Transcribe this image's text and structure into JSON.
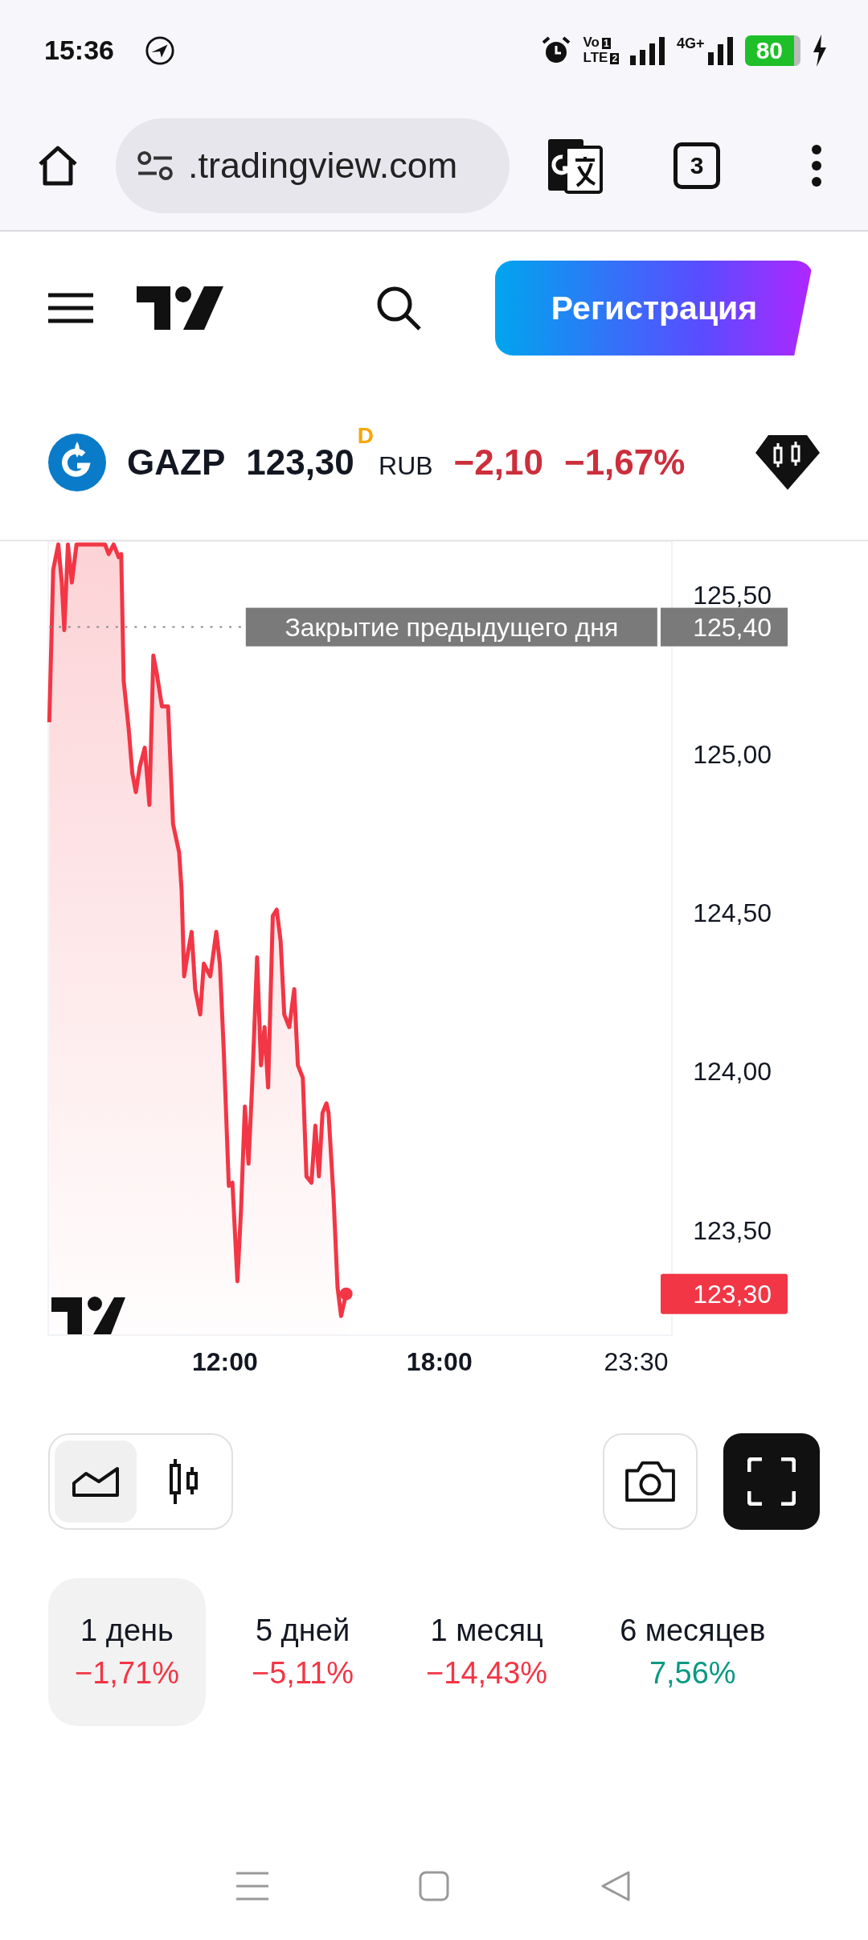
{
  "status_bar": {
    "time": "15:36",
    "volte_top": "Vo",
    "volte_bottom": "LTE",
    "sims": [
      "1",
      "2"
    ],
    "network": "4G+",
    "battery": "80"
  },
  "browser": {
    "url": ".tradingview.com",
    "tab_count": "3"
  },
  "header": {
    "signup_button": "Регистрация"
  },
  "ticker": {
    "symbol": "GAZP",
    "price": "123,30",
    "badge": "D",
    "currency": "RUB",
    "change": "−2,10",
    "change_percent": "−1,67%"
  },
  "chart": {
    "previous_close_value": "125,40",
    "last_price": "123,30",
    "chart_data": {
      "type": "area",
      "xlim": [
        7.06,
        24.5
      ],
      "ylim": [
        123.17,
        125.67
      ],
      "xticks": [
        {
          "value": 12,
          "label": "12:00"
        },
        {
          "value": 18,
          "label": "18:00"
        },
        {
          "value": 23.5,
          "label": "23:30"
        }
      ],
      "yticks": [
        {
          "value": 123.5,
          "label": "123,50"
        },
        {
          "value": 124,
          "label": "124,00"
        },
        {
          "value": 124.5,
          "label": "124,50"
        },
        {
          "value": 125,
          "label": "125,00"
        },
        {
          "value": 125.5,
          "label": "125,50"
        }
      ],
      "x": [
        7.09,
        7.2,
        7.34,
        7.44,
        7.51,
        7.61,
        7.72,
        7.85,
        8.13,
        8.65,
        8.75,
        8.89,
        9.03,
        9.1,
        9.17,
        9.31,
        9.41,
        9.51,
        9.62,
        9.76,
        9.89,
        10.0,
        10.1,
        10.24,
        10.41,
        10.55,
        10.72,
        10.79,
        10.86,
        10.96,
        11.07,
        11.17,
        11.31,
        11.41,
        11.59,
        11.76,
        11.86,
        11.97,
        12.11,
        12.21,
        12.35,
        12.45,
        12.56,
        12.66,
        12.76,
        12.9,
        13.01,
        13.11,
        13.21,
        13.34,
        13.45,
        13.56,
        13.66,
        13.8,
        13.94,
        14.04,
        14.18,
        14.28,
        14.42,
        14.53,
        14.63,
        14.73,
        14.84,
        14.9,
        15.04,
        15.15,
        15.25,
        15.39
      ],
      "series": [
        {
          "color": "#f23645",
          "values": [
            125.1,
            125.58,
            125.66,
            125.54,
            125.39,
            125.66,
            125.54,
            125.66,
            125.66,
            125.66,
            125.63,
            125.66,
            125.62,
            125.63,
            125.23,
            125.08,
            124.94,
            124.88,
            124.96,
            125.02,
            124.84,
            125.31,
            125.25,
            125.15,
            125.15,
            124.78,
            124.69,
            124.57,
            124.3,
            124.37,
            124.44,
            124.26,
            124.18,
            124.34,
            124.3,
            124.44,
            124.34,
            124.06,
            123.64,
            123.65,
            123.34,
            123.56,
            123.89,
            123.71,
            123.95,
            124.36,
            124.02,
            124.14,
            123.95,
            124.49,
            124.51,
            124.41,
            124.18,
            124.14,
            124.26,
            124.02,
            123.98,
            123.67,
            123.65,
            123.83,
            123.67,
            123.87,
            123.9,
            123.87,
            123.6,
            123.32,
            123.23,
            123.3
          ]
        },
        {
          "name": "Закрытие предыдущего дня",
          "type": "line",
          "line_style": "dotted",
          "color": "#888888",
          "values": [
            125.4,
            125.4,
            125.4,
            125.4,
            125.4,
            125.4,
            125.4,
            125.4,
            125.4,
            125.4,
            125.4,
            125.4,
            125.4,
            125.4,
            125.4,
            125.4,
            125.4,
            125.4,
            125.4,
            125.4,
            125.4,
            125.4,
            125.4,
            125.4,
            125.4,
            125.4,
            125.4,
            125.4,
            125.4,
            125.4,
            125.4,
            125.4,
            125.4,
            125.4,
            125.4,
            125.4,
            125.4,
            125.4,
            125.4,
            125.4,
            125.4,
            125.4,
            null,
            null,
            null,
            null,
            null,
            null,
            null,
            null,
            null,
            null,
            null,
            null,
            null,
            null,
            null,
            null,
            null,
            null,
            null,
            null,
            null,
            null,
            null,
            null,
            null,
            null
          ]
        }
      ]
    }
  },
  "chart_types": [
    {
      "kind": "area",
      "selected": true
    },
    {
      "kind": "candles",
      "selected": false
    }
  ],
  "periods": [
    {
      "label": "1 день",
      "change": "−1,71%",
      "color": "#f23645",
      "selected": true
    },
    {
      "label": "5 дней",
      "change": "−5,11%",
      "color": "#f23645",
      "selected": false
    },
    {
      "label": "1 месяц",
      "change": "−14,43%",
      "color": "#f23645",
      "selected": false
    },
    {
      "label": "6 месяцев",
      "change": "7,56%",
      "color": "#089981",
      "selected": false
    }
  ]
}
